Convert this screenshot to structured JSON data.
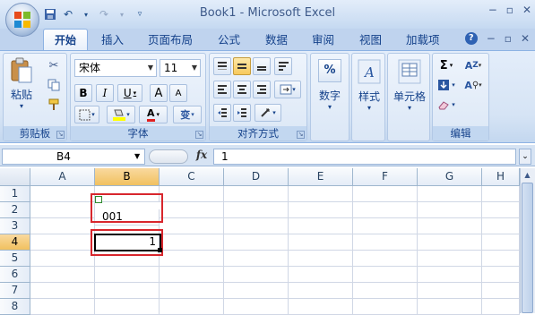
{
  "window": {
    "title": "Book1 - Microsoft Excel",
    "controls": [
      "−",
      "▫",
      "✕"
    ]
  },
  "qat": {
    "save_icon": "save-icon",
    "undo_icon": "undo-icon",
    "redo_icon": "redo-icon",
    "customize_icon": "chevron-down-icon"
  },
  "tabs": [
    {
      "label": "开始",
      "active": true
    },
    {
      "label": "插入"
    },
    {
      "label": "页面布局"
    },
    {
      "label": "公式"
    },
    {
      "label": "数据"
    },
    {
      "label": "审阅"
    },
    {
      "label": "视图"
    },
    {
      "label": "加载项"
    }
  ],
  "ribbon_controls": [
    "?",
    "−",
    "▫",
    "✕"
  ],
  "ribbon": {
    "clipboard": {
      "label": "剪贴板",
      "paste": "粘贴"
    },
    "font": {
      "label": "字体",
      "font_name": "宋体",
      "font_size": "11",
      "bold": "B",
      "italic": "I",
      "underline": "U",
      "grow": "A",
      "shrink": "A",
      "font_color": "A",
      "phonetic": "变"
    },
    "alignment": {
      "label": "对齐方式"
    },
    "number": {
      "label": "数字",
      "symbol": "%"
    },
    "styles": {
      "label": "样式"
    },
    "cells": {
      "label": "单元格"
    },
    "editing": {
      "label": "编辑",
      "sum": "Σ",
      "sort": "A",
      "find": "A"
    }
  },
  "formula_bar": {
    "name_box": "B4",
    "fx": "fx",
    "value": "1"
  },
  "grid": {
    "columns": [
      "A",
      "B",
      "C",
      "D",
      "E",
      "F",
      "G",
      "H"
    ],
    "rows": [
      "1",
      "2",
      "3",
      "4",
      "5",
      "6",
      "7",
      "8"
    ],
    "selected_column": "B",
    "selected_row": "4",
    "cells": {
      "B2": "001",
      "B4": "1"
    }
  },
  "colors": {
    "highlight_border": "#d8262d",
    "header_selected": "#f1c15f",
    "ribbon_text": "#15428b"
  }
}
